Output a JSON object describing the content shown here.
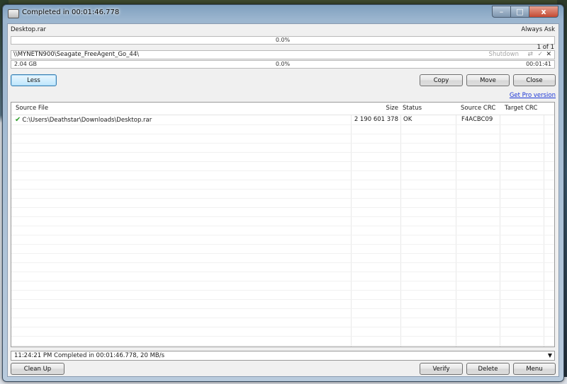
{
  "window": {
    "title": "Completed in 00:01:46.778",
    "min_glyph": "–",
    "max_glyph": "□",
    "close_glyph": "x"
  },
  "source": {
    "file": "Desktop.rar",
    "mode": "Always Ask",
    "progress_pct": "0.0%",
    "progress_value": 0,
    "count": "1 of 1"
  },
  "destination": {
    "path": "\\\\MYNETN900\\Seagate_FreeAgent_Go_44\\",
    "shutdown_label": "Shutdown"
  },
  "total": {
    "size": "2.04 GB",
    "progress_pct": "0.0%",
    "progress_value": 0,
    "time": "00:01:41"
  },
  "buttons": {
    "less": "Less",
    "copy": "Copy",
    "move": "Move",
    "close": "Close",
    "pro": "Get Pro version",
    "clean_up": "Clean Up",
    "verify": "Verify",
    "delete": "Delete",
    "menu": "Menu"
  },
  "table": {
    "columns": [
      "Source File",
      "Size",
      "Status",
      "Source CRC",
      "Target CRC"
    ],
    "rows": [
      {
        "file": "C:\\Users\\Deathstar\\Downloads\\Desktop.rar",
        "size": "2 190 601 378",
        "status": "OK",
        "source_crc": "F4ACBC09",
        "target_crc": ""
      }
    ]
  },
  "status": {
    "text": "11:24:21 PM Completed in 00:01:46.778, 20 MB/s"
  },
  "colors": {
    "ok_check": "#2e9e2a",
    "link": "#1a35d6",
    "close_button": "#c44a33"
  }
}
